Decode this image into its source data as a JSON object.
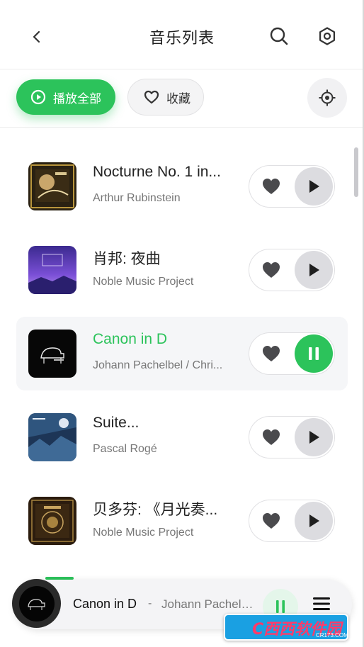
{
  "header": {
    "title": "音乐列表",
    "back_icon": "chevron-left-icon",
    "search_icon": "search-icon",
    "settings_icon": "gear-icon"
  },
  "toolbar": {
    "play_all_label": "播放全部",
    "favorites_label": "收藏",
    "locate_icon": "locate-icon"
  },
  "tracks": [
    {
      "title": "Nocturne No. 1 in...",
      "artist": "Arthur Rubinstein",
      "active": false
    },
    {
      "title": "肖邦: 夜曲",
      "artist": "Noble Music Project",
      "active": false
    },
    {
      "title": "Canon in D",
      "artist": "Johann Pachelbel / Chri...",
      "active": true
    },
    {
      "title": "Suite...",
      "artist": "Pascal Rogé",
      "active": false
    },
    {
      "title": "贝多芬: 《月光奏...",
      "artist": "Noble Music Project",
      "active": false
    }
  ],
  "mini_player": {
    "title": "Canon in D",
    "separator": "-",
    "artist": "Johann Pachelb...",
    "state": "playing"
  },
  "watermark": {
    "text": "C西西软件园",
    "domain": "CR173.COM"
  },
  "colors": {
    "accent": "#2cc35b",
    "text_primary": "#222222",
    "text_secondary": "#777777",
    "button_gray": "#dcdce0"
  }
}
